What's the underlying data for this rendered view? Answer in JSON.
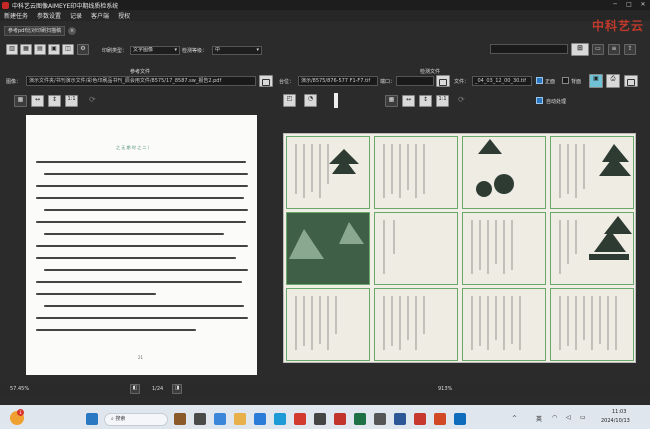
{
  "window": {
    "title": "中科艺云图像AIMEYE印中期线质检系统",
    "brand": "中科艺云"
  },
  "menu": [
    "新建任务",
    "参数设置",
    "记录",
    "客户端",
    "授权"
  ],
  "tab": {
    "label": "参考pdf比对印刷扫描稿"
  },
  "toolbar": {
    "print_type_label": "印刷类型：",
    "print_type_value": "文字图像",
    "detect_level_label": "检测等级：",
    "detect_level_value": "中"
  },
  "reference": {
    "section_title": "参考文件",
    "image_label": "图像：",
    "image_path": "演示文件夹/书刊演示文件/彩色印刷品书刊_辰会用文件/8575/17_8587.sw_报告2.pdf",
    "zoom": "57.45%",
    "page_current": "1",
    "page_total": "1/24"
  },
  "inspection": {
    "section_title": "检测文件",
    "path_label": "台位：",
    "path_value": "演示/8575/876-577 F1-F7.tif",
    "port_label": "端口：",
    "file_label": "文件：",
    "file_value": "_04_03_12_00_30.tif",
    "front_label": "正面",
    "back_label": "背面",
    "auto_flip_label": "自动处理",
    "zoom": "913%"
  },
  "document": {
    "header": "之 无 期 时 之 二 ）",
    "page_number": "21"
  },
  "taskbar": {
    "search_placeholder": "搜索",
    "time": "11:03",
    "date": "2024/10/13",
    "ime": "英",
    "badge": "1"
  },
  "colors": {
    "brand": "#c0392b",
    "tile_border": "#6aa76a",
    "tile_green": "#3f5f46",
    "accent_blue": "#2b78c2"
  }
}
